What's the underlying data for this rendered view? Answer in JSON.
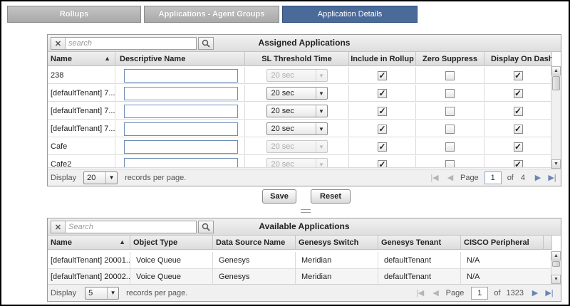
{
  "tabs": [
    {
      "label": "Rollups",
      "active": false
    },
    {
      "label": "Applications - Agent Groups",
      "active": false
    },
    {
      "label": "Application Details",
      "active": true
    }
  ],
  "assigned": {
    "title": "Assigned Applications",
    "search_placeholder": "search",
    "columns": [
      "Name",
      "Descriptive Name",
      "SL Threshold Time",
      "Include in Rollup",
      "Zero Suppress",
      "Display On Dashb"
    ],
    "rows": [
      {
        "name": "238",
        "descriptive": "",
        "sl": "20 sec",
        "sl_disabled": true,
        "include": true,
        "zero": false,
        "display": true
      },
      {
        "name": "[defaultTenant] 7...",
        "descriptive": "",
        "sl": "20 sec",
        "sl_disabled": false,
        "include": true,
        "zero": false,
        "display": true
      },
      {
        "name": "[defaultTenant] 7...",
        "descriptive": "",
        "sl": "20 sec",
        "sl_disabled": false,
        "include": true,
        "zero": false,
        "display": true
      },
      {
        "name": "[defaultTenant] 7...",
        "descriptive": "",
        "sl": "20 sec",
        "sl_disabled": false,
        "include": true,
        "zero": false,
        "display": true
      },
      {
        "name": "Cafe",
        "descriptive": "",
        "sl": "20 sec",
        "sl_disabled": true,
        "include": true,
        "zero": false,
        "display": true
      },
      {
        "name": "Cafe2",
        "descriptive": "",
        "sl": "20 sec",
        "sl_disabled": true,
        "include": true,
        "zero": false,
        "display": true
      }
    ],
    "footer": {
      "display_label": "Display",
      "per_page": "20",
      "records_label": "records per page.",
      "page_label": "Page",
      "page": "1",
      "of_label": "of",
      "total_pages": "4"
    }
  },
  "buttons": {
    "save": "Save",
    "reset": "Reset"
  },
  "available": {
    "title": "Available Applications",
    "search_placeholder": "Search",
    "columns": [
      "Name",
      "Object Type",
      "Data Source Name",
      "Genesys Switch",
      "Genesys Tenant",
      "CISCO Peripheral"
    ],
    "rows": [
      {
        "name": "[defaultTenant] 20001...",
        "type": "Voice Queue",
        "source": "Genesys",
        "switch": "Meridian",
        "tenant": "defaultTenant",
        "cisco": "N/A"
      },
      {
        "name": "[defaultTenant] 20002...",
        "type": "Voice Queue",
        "source": "Genesys",
        "switch": "Meridian",
        "tenant": "defaultTenant",
        "cisco": "N/A"
      }
    ],
    "footer": {
      "display_label": "Display",
      "per_page": "5",
      "records_label": "records per page.",
      "page_label": "Page",
      "page": "1",
      "of_label": "of",
      "total_pages": "1323"
    }
  },
  "icons": {
    "clear": "clear-icon",
    "search": "magnifier-icon",
    "sort_asc": "sort-up-icon",
    "checkmark": "check-icon"
  }
}
